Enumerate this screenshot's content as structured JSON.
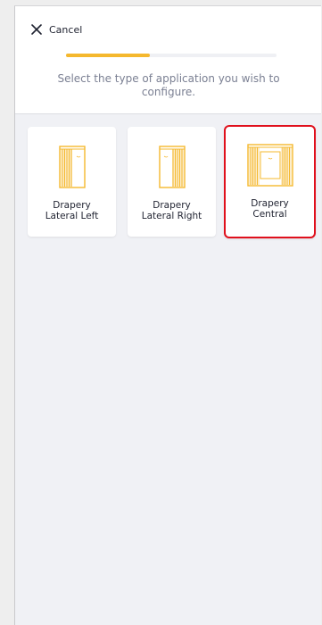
{
  "header": {
    "cancel_label": "Cancel",
    "progress": 0.4,
    "progress_color": "#f5b82e",
    "prompt": "Select the type of application you wish to configure."
  },
  "options": [
    {
      "line1": "Drapery",
      "line2": "Lateral Left",
      "icon": "drapery-lateral-left-icon",
      "selected": false
    },
    {
      "line1": "Drapery",
      "line2": "Lateral Right",
      "icon": "drapery-lateral-right-icon",
      "selected": false
    },
    {
      "line1": "Drapery",
      "line2": "Central",
      "icon": "drapery-central-icon",
      "selected": true
    }
  ],
  "colors": {
    "accent": "#f5b82e",
    "selection": "#e0101c",
    "background": "#f0f1f5"
  }
}
